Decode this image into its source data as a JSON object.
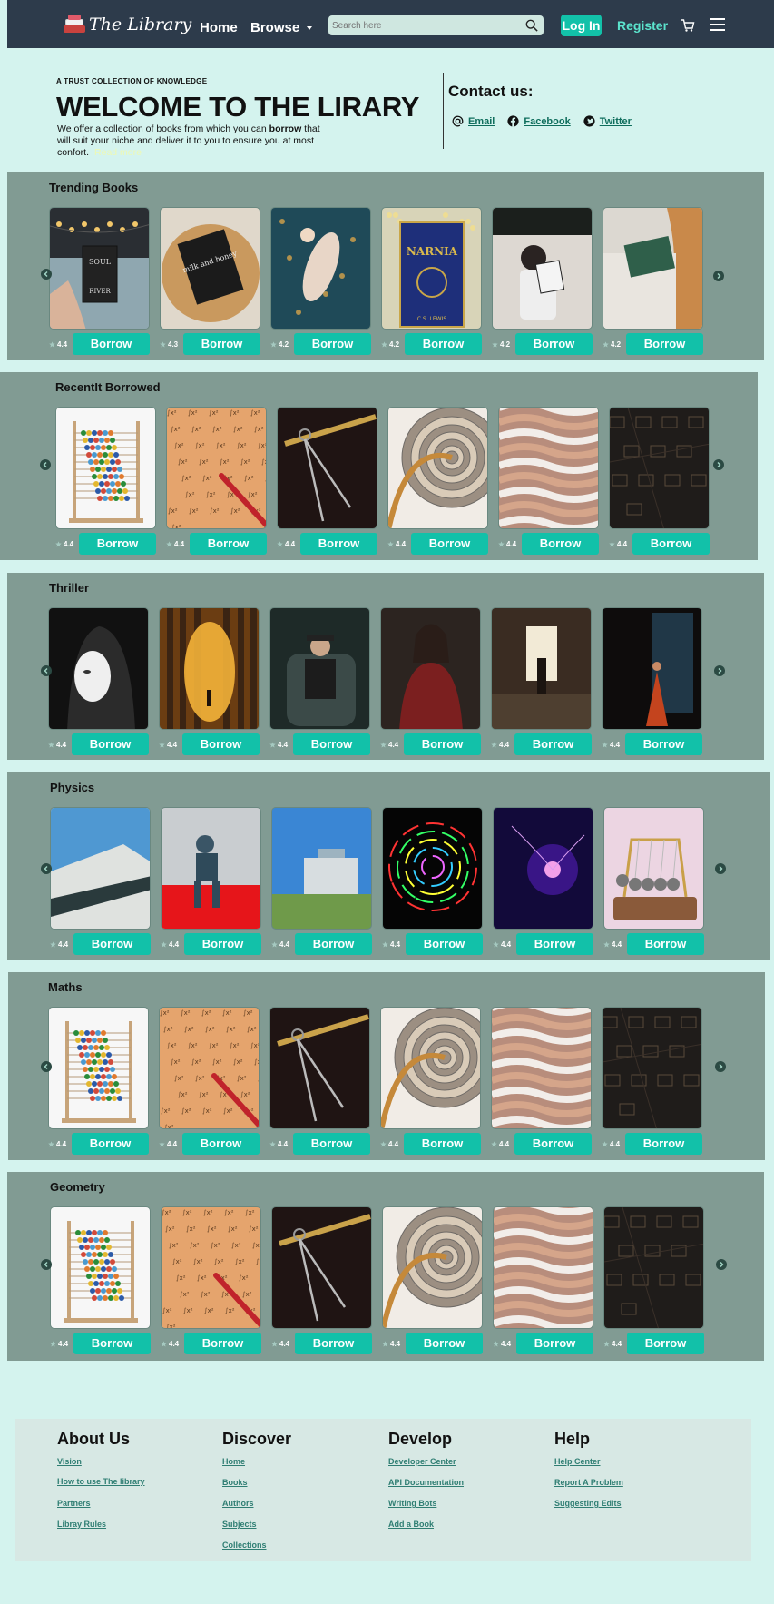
{
  "brand": {
    "name": "The Library"
  },
  "nav": {
    "home": "Home",
    "browse": "Browse",
    "search_placeholder": "Search here",
    "login": "Log In",
    "register": "Register"
  },
  "hero": {
    "tagline": "A TRUST COLLECTION OF KNOWLEDGE",
    "title": "WELCOME TO THE LIRARY",
    "desc_part1": "We offer a collection of books from which you can ",
    "desc_bold": "borrow",
    "desc_part2": " that will suit your  niche and deliver it to you to ensure you at most confort.",
    "read_more": "Read more"
  },
  "contact": {
    "title": "Contact us:",
    "email": "Email",
    "facebook": "Facebook",
    "twitter": "Twitter"
  },
  "borrow_label": "Borrow",
  "sections": [
    {
      "title": "Trending Books",
      "ratings": [
        "4.4",
        "4.3",
        "4.2",
        "4.2",
        "4.2",
        "4.2"
      ]
    },
    {
      "title": "RecentIt Borrowed",
      "ratings": [
        "4.4",
        "4.4",
        "4.4",
        "4.4",
        "4.4",
        "4.4"
      ]
    },
    {
      "title": "Thriller",
      "ratings": [
        "4.4",
        "4.4",
        "4.4",
        "4.4",
        "4.4",
        "4.4"
      ]
    },
    {
      "title": "Physics",
      "ratings": [
        "4.4",
        "4.4",
        "4.4",
        "4.4",
        "4.4",
        "4.4"
      ]
    },
    {
      "title": "Maths",
      "ratings": [
        "4.4",
        "4.4",
        "4.4",
        "4.4",
        "4.4",
        "4.4"
      ]
    },
    {
      "title": "Geometry",
      "ratings": [
        "4.4",
        "4.4",
        "4.4",
        "4.4",
        "4.4",
        "4.4"
      ]
    }
  ],
  "cover_text": {
    "soul_river": [
      "SOUL",
      "RIVER"
    ],
    "milk_honey": "milk and honey",
    "narnia": "NARNIA",
    "narnia_author": "C.S. LEWIS"
  },
  "footer": {
    "about": {
      "title": "About Us",
      "links": [
        "Vision",
        "How to use The library",
        "Partners",
        "Libray Rules"
      ]
    },
    "discover": {
      "title": "Discover",
      "links": [
        "Home",
        "Books",
        "Authors",
        "Subjects",
        "Collections"
      ]
    },
    "develop": {
      "title": "Develop",
      "links": [
        "Developer Center",
        "API Documentation",
        "Writing Bots",
        "Add a Book"
      ]
    },
    "help": {
      "title": "Help",
      "links": [
        "Help Center",
        "Report A Problem",
        "Suggesting Edits"
      ]
    }
  },
  "colors": {
    "nav_bg": "#2d3b4b",
    "accent": "#12c1a9",
    "page_bg": "#d4f3ee",
    "band_bg": "#819b93"
  },
  "icons": [
    "search-icon",
    "cart-icon",
    "menu-icon",
    "at-icon",
    "facebook-icon",
    "twitter-icon",
    "star-icon",
    "arrow-left-icon",
    "arrow-right-icon"
  ]
}
